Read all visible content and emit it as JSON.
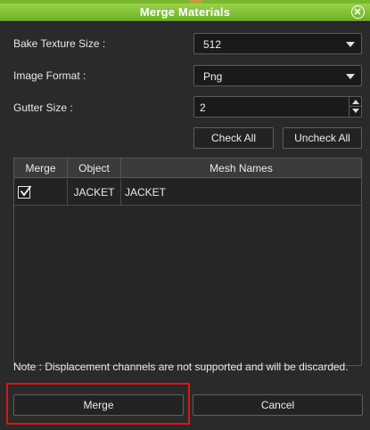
{
  "dialog": {
    "title": "Merge Materials"
  },
  "form": {
    "bake_texture_size": {
      "label": "Bake Texture Size :",
      "value": "512"
    },
    "image_format": {
      "label": "Image Format :",
      "value": "Png"
    },
    "gutter_size": {
      "label": "Gutter Size :",
      "value": "2"
    }
  },
  "actions": {
    "check_all": "Check All",
    "uncheck_all": "Uncheck All",
    "merge": "Merge",
    "cancel": "Cancel"
  },
  "table": {
    "columns": [
      "Merge",
      "Object",
      "Mesh Names"
    ],
    "rows": [
      {
        "checked": true,
        "object": "JACKET",
        "mesh": "JACKET"
      }
    ]
  },
  "note": "Note : Displacement channels are not supported and will be discarded.",
  "colors": {
    "title_bar": "#79b82c",
    "highlight": "#e01414"
  }
}
